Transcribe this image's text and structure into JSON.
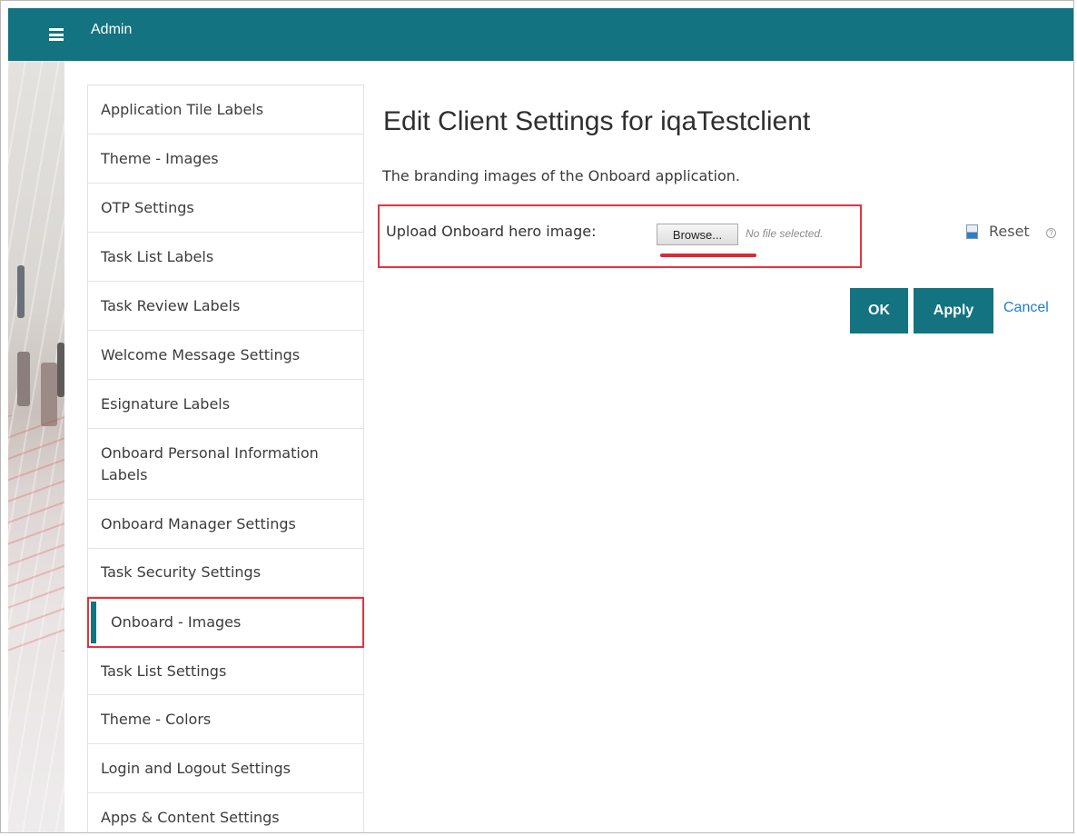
{
  "topbar": {
    "title": "Admin",
    "menu_icon": "hamburger-menu-icon",
    "color": "#137380"
  },
  "sidebar": {
    "items": [
      {
        "label": "Application Tile Labels"
      },
      {
        "label": "Theme - Images"
      },
      {
        "label": "OTP Settings"
      },
      {
        "label": "Task List Labels"
      },
      {
        "label": "Task Review Labels"
      },
      {
        "label": "Welcome Message Settings"
      },
      {
        "label": "Esignature Labels"
      },
      {
        "label": "Onboard Personal Information Labels"
      },
      {
        "label": "Onboard Manager Settings"
      },
      {
        "label": "Task Security Settings"
      },
      {
        "label": "Onboard - Images",
        "active": true
      },
      {
        "label": "Task List Settings"
      },
      {
        "label": "Theme - Colors"
      },
      {
        "label": "Login and Logout Settings"
      },
      {
        "label": "Apps & Content Settings"
      }
    ]
  },
  "main": {
    "title": "Edit Client Settings for iqaTestclient",
    "description": "The branding images of the Onboard application.",
    "upload": {
      "label": "Upload Onboard hero image:",
      "browse_label": "Browse...",
      "file_status": "No file selected."
    },
    "reset_label": "Reset",
    "reset_icon": "reset-document-icon",
    "help_icon": "help-icon",
    "actions": {
      "ok_label": "OK",
      "apply_label": "Apply",
      "cancel_label": "Cancel"
    }
  },
  "colors": {
    "accent": "#137380",
    "highlight": "#e3343f",
    "link": "#1f7fc8"
  }
}
